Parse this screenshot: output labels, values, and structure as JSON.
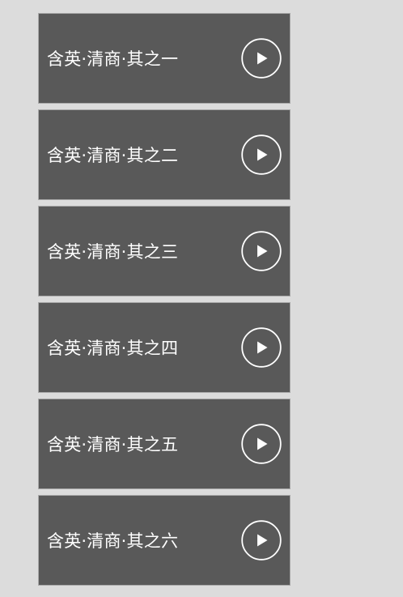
{
  "track_list": {
    "items": [
      {
        "title": "含英·清商·其之一",
        "play_icon": "play-circle-icon"
      },
      {
        "title": "含英·清商·其之二",
        "play_icon": "play-circle-icon"
      },
      {
        "title": "含英·清商·其之三",
        "play_icon": "play-circle-icon"
      },
      {
        "title": "含英·清商·其之四",
        "play_icon": "play-circle-icon"
      },
      {
        "title": "含英·清商·其之五",
        "play_icon": "play-circle-icon"
      },
      {
        "title": "含英·清商·其之六",
        "play_icon": "play-circle-icon"
      }
    ]
  },
  "colors": {
    "page_background": "#dcdcdc",
    "card_background": "#595959",
    "card_border": "#a9a9a9",
    "text": "#ffffff",
    "icon": "#ffffff"
  }
}
